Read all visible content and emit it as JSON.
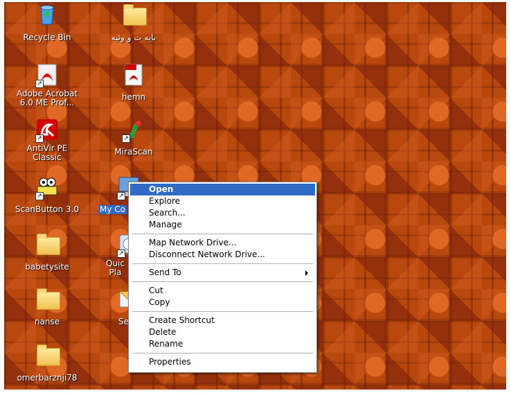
{
  "desktop_icons": [
    {
      "label": "Recycle Bin",
      "icon": "recycle-bin-icon"
    },
    {
      "label": "بایه ت و وثیه",
      "icon": "folder-icon"
    },
    {
      "label": "Adobe Acrobat\n6.0 ME Prof...",
      "icon": "adobe-acrobat-icon"
    },
    {
      "label": "hemn",
      "icon": "pdf-file-icon"
    },
    {
      "label": "AntiVir PE\nClassic",
      "icon": "antivir-icon"
    },
    {
      "label": "MiraScan",
      "icon": "mirascan-icon"
    },
    {
      "label": "ScanButton 3.0",
      "icon": "scanbutton-icon"
    },
    {
      "label": "My Co",
      "icon": "my-computer-icon"
    },
    {
      "label": "babetysite",
      "icon": "folder-icon"
    },
    {
      "label": "Quic\nPla",
      "icon": "quick-play-icon"
    },
    {
      "label": "nanse",
      "icon": "folder-icon"
    },
    {
      "label": "Se",
      "icon": "send-icon"
    },
    {
      "label": "omerbarznji78",
      "icon": "folder-icon"
    }
  ],
  "context_menu": {
    "items": [
      {
        "label": "Open"
      },
      {
        "label": "Explore"
      },
      {
        "label": "Search..."
      },
      {
        "label": "Manage"
      },
      {
        "label": "Map Network Drive..."
      },
      {
        "label": "Disconnect Network Drive..."
      },
      {
        "label": "Send To"
      },
      {
        "label": "Cut"
      },
      {
        "label": "Copy"
      },
      {
        "label": "Create Shortcut"
      },
      {
        "label": "Delete"
      },
      {
        "label": "Rename"
      },
      {
        "label": "Properties"
      }
    ]
  },
  "colors": {
    "highlight": "#316ac5",
    "desktop_base": "#b8480e"
  }
}
